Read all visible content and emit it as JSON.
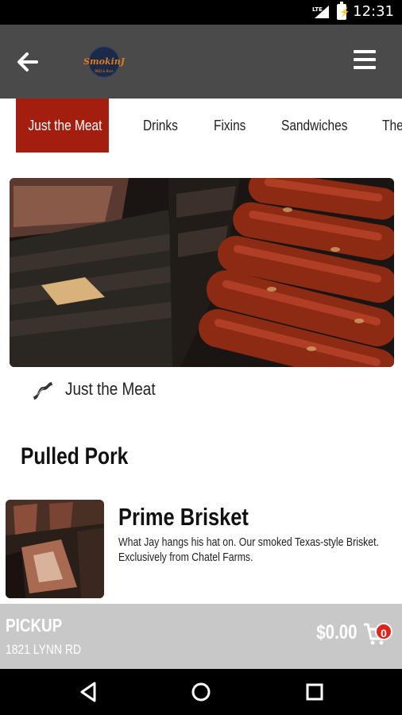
{
  "status_bar": {
    "time": "12:31",
    "network": "LTE",
    "icons": [
      "lte-signal-icon",
      "battery-icon"
    ]
  },
  "app_bar": {
    "back_icon": "arrow-left-icon",
    "logo_text": "SmokinJ",
    "logo_sub": "BBQ & Bars",
    "menu_icon": "hamburger-menu-icon"
  },
  "tabs": [
    {
      "label": "Just the Meat",
      "active": true
    },
    {
      "label": "Drinks",
      "active": false
    },
    {
      "label": "Fixins",
      "active": false
    },
    {
      "label": "Sandwiches",
      "active": false
    },
    {
      "label": "The",
      "active": false
    }
  ],
  "category": {
    "icon": "bacon-icon",
    "label": "Just the Meat"
  },
  "section": {
    "title": "Pulled Pork"
  },
  "items": [
    {
      "name": "Prime Brisket",
      "description": "What Jay hangs his hat on. Our smoked Texas-style Brisket. Exclusively from Chatel Farms."
    }
  ],
  "cart_bar": {
    "pickup_label": "PICKUP",
    "address": "1821 LYNN RD",
    "total": "$0.00",
    "count": "0",
    "icon": "cart-icon"
  },
  "nav_bar": {
    "icons": [
      "back-triangle-icon",
      "home-circle-icon",
      "recents-square-icon"
    ]
  },
  "colors": {
    "accent": "#a41e10",
    "app_bar": "#4a4a4a",
    "cart_bar": "#c8c8c8",
    "badge": "#e0241b"
  }
}
